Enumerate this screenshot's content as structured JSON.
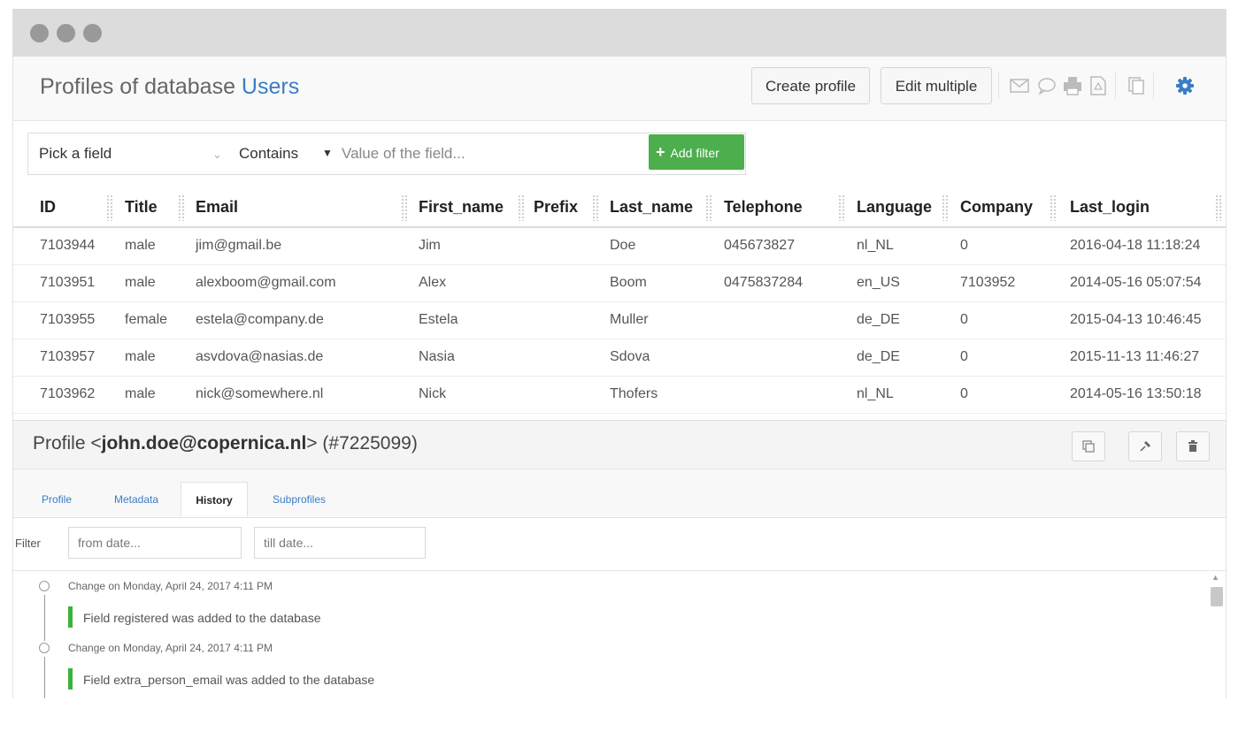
{
  "header": {
    "title_prefix": "Profiles of database ",
    "database_name": "Users",
    "create_profile_label": "Create profile",
    "edit_multiple_label": "Edit multiple",
    "icons": [
      "mail-icon",
      "chat-icon",
      "print-icon",
      "pdf-icon",
      "copy-icon",
      "gear-icon"
    ],
    "accent_color": "#3a7dc5"
  },
  "filter": {
    "field_placeholder": "Pick a field",
    "operator": "Contains",
    "value_placeholder": "Value of the field...",
    "add_label": "Add filter",
    "add_color": "#4cae4c"
  },
  "table": {
    "columns": [
      "ID",
      "Title",
      "Email",
      "First_name",
      "Prefix",
      "Last_name",
      "Telephone",
      "Language",
      "Company",
      "Last_login"
    ],
    "rows": [
      [
        "7103944",
        "male",
        "jim@gmail.be",
        "Jim",
        "",
        "Doe",
        "045673827",
        "nl_NL",
        "0",
        "2016-04-18 11:18:24"
      ],
      [
        "7103951",
        "male",
        "alexboom@gmail.com",
        "Alex",
        "",
        "Boom",
        "0475837284",
        "en_US",
        "7103952",
        "2014-05-16 05:07:54"
      ],
      [
        "7103955",
        "female",
        "estela@company.de",
        "Estela",
        "",
        "Muller",
        "",
        "de_DE",
        "0",
        "2015-04-13 10:46:45"
      ],
      [
        "7103957",
        "male",
        "asvdova@nasias.de",
        "Nasia",
        "",
        "Sdova",
        "",
        "de_DE",
        "0",
        "2015-11-13 11:46:27"
      ],
      [
        "7103962",
        "male",
        "nick@somewhere.nl",
        "Nick",
        "",
        "Thofers",
        "",
        "nl_NL",
        "0",
        "2014-05-16 13:50:18"
      ]
    ]
  },
  "profile": {
    "prefix": "Profile <",
    "email": "john.doe@copernica.nl",
    "suffix": "> (#7225099)",
    "tabs": [
      "Profile",
      "Metadata",
      "History",
      "Subprofiles"
    ],
    "active_tab": "History",
    "history_filter": {
      "label": "Filter",
      "from_placeholder": "from date...",
      "till_placeholder": "till date..."
    },
    "history": [
      {
        "date": "Change on Monday, April 24, 2017 4:11 PM",
        "text": "Field registered was added to the database"
      },
      {
        "date": "Change on Monday, April 24, 2017 4:11 PM",
        "text": "Field extra_person_email was added to the database"
      }
    ],
    "change_color": "#3cb33c"
  }
}
